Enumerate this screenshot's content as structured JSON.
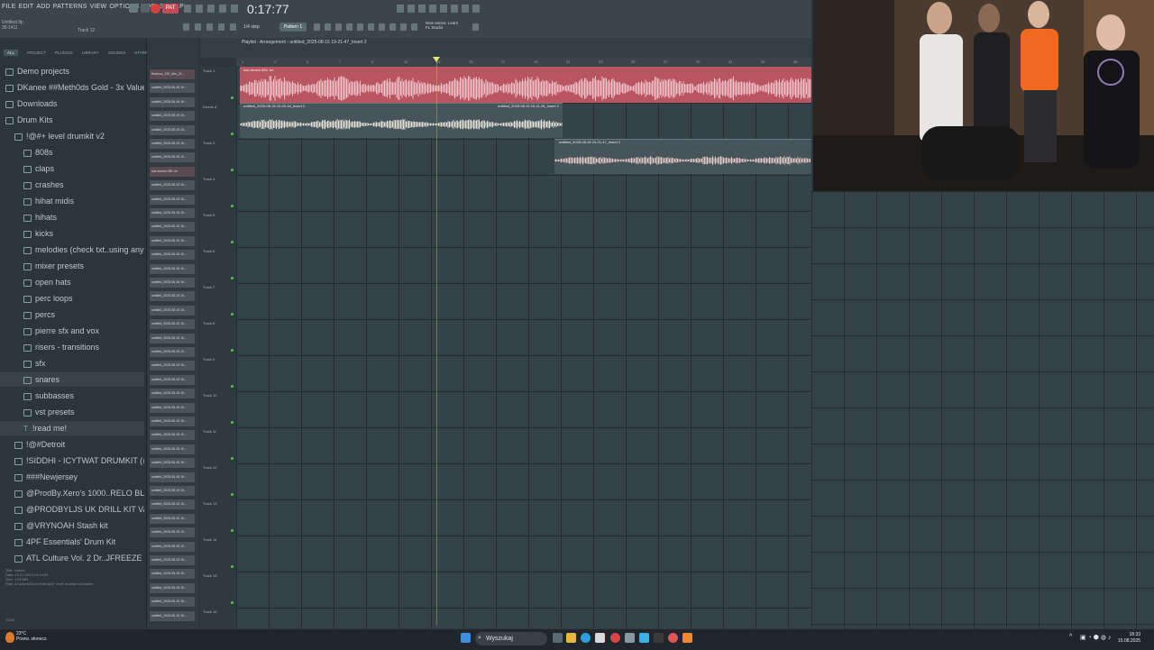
{
  "menu": [
    "FILE",
    "EDIT",
    "ADD",
    "PATTERNS",
    "VIEW",
    "OPTIONS",
    "TOOLS",
    "HELP"
  ],
  "transport": {
    "pattern_label": "PAT",
    "time": "0:17:77",
    "tempo_label": "1/4 step",
    "pattern_select": "Pattern 1"
  },
  "project_info": {
    "name": "Untitled.flp",
    "position": "36:1411",
    "track": "Track 12"
  },
  "news": [
    "New series: Learn",
    "FL Studio"
  ],
  "browser": {
    "tabs": [
      "ALL",
      "PROJECT",
      "PLUGINS",
      "LIBRARY",
      "SOUNDS",
      "STARRED"
    ],
    "items": [
      {
        "label": "Demo projects",
        "type": "folder",
        "indent": 0
      },
      {
        "label": "DKanee ##Meth0ds Gold - 3x Value Collection",
        "type": "folder",
        "indent": 0
      },
      {
        "label": "Downloads",
        "type": "folder",
        "indent": 0
      },
      {
        "label": "Drum Kits",
        "type": "folder",
        "indent": 0
      },
      {
        "label": "!@#+ level drumkit v2",
        "type": "folder",
        "indent": 1
      },
      {
        "label": "808s",
        "type": "folder",
        "indent": 2
      },
      {
        "label": "claps",
        "type": "folder",
        "indent": 2
      },
      {
        "label": "crashes",
        "type": "folder",
        "indent": 2
      },
      {
        "label": "hihat midis",
        "type": "folder",
        "indent": 2
      },
      {
        "label": "hihats",
        "type": "folder",
        "indent": 2
      },
      {
        "label": "kicks",
        "type": "folder",
        "indent": 2
      },
      {
        "label": "melodies (check txt..using any of these)",
        "type": "folder",
        "indent": 2
      },
      {
        "label": "mixer presets",
        "type": "folder",
        "indent": 2
      },
      {
        "label": "open hats",
        "type": "folder",
        "indent": 2
      },
      {
        "label": "perc loops",
        "type": "folder",
        "indent": 2
      },
      {
        "label": "percs",
        "type": "folder",
        "indent": 2
      },
      {
        "label": "pierre sfx and vox",
        "type": "folder",
        "indent": 2
      },
      {
        "label": "risers - transitions",
        "type": "folder",
        "indent": 2
      },
      {
        "label": "sfx",
        "type": "folder",
        "indent": 2
      },
      {
        "label": "snares",
        "type": "folder",
        "indent": 2,
        "selected": true
      },
      {
        "label": "subbasses",
        "type": "folder",
        "indent": 2
      },
      {
        "label": "vst presets",
        "type": "folder",
        "indent": 2
      },
      {
        "label": "!read me!",
        "type": "file",
        "indent": 2,
        "selected": true
      },
      {
        "label": "!@#Detroit",
        "type": "folder",
        "indent": 1
      },
      {
        "label": "!SIDDHI - ICYTWAT DRUMKIT (@SIMON)",
        "type": "folder",
        "indent": 1
      },
      {
        "label": "###Newjersey",
        "type": "folder",
        "indent": 1
      },
      {
        "label": "@ProdBy.Xero's 1000..RELO BLEH MEGA KIT",
        "type": "folder",
        "indent": 1
      },
      {
        "label": "@PRODBYLJS UK DRILL KIT VACCINE",
        "type": "folder",
        "indent": 1
      },
      {
        "label": "@VRYNOAH Stash kit",
        "type": "folder",
        "indent": 1
      },
      {
        "label": "4PF Essentials' Drum Kit",
        "type": "folder",
        "indent": 1
      },
      {
        "label": "ATL Culture Vol. 2 Dr..JFREEZE & Mike Fuego",
        "type": "folder",
        "indent": 1
      }
    ],
    "file_info": [
      "Title: snares",
      "Date: 19.07.2023 19:44:53",
      "Size: 1.52 MB",
      "Path: D:\\Users\\Drum Kits\\!@#+ level drumkit v2\\snares"
    ],
    "tags_label": "TAGS"
  },
  "channels": [
    "Beatscz_152_dfm_01...",
    "untitled_2025-08-15 19...",
    "untitled_2025-08-15 19...",
    "untitled_2025-08-15 19...",
    "untitled_2025-08-15 19...",
    "untitled_2025-08-15 19...",
    "untitled_2025-08-15 19...",
    "lost dshwa 089 .tm",
    "untitled_2025-08-15 19...",
    "untitled_2025-08-15 19...",
    "untitled_2025-08-15 19...",
    "untitled_2025-08-15 19...",
    "untitled_2025-08-15 19...",
    "untitled_2025-08-15 19...",
    "untitled_2025-08-15 19...",
    "untitled_2025-08-15 19...",
    "untitled_2025-08-15 19...",
    "untitled_2025-08-15 19...",
    "untitled_2025-08-15 19...",
    "untitled_2025-08-15 19...",
    "untitled_2025-08-15 19...",
    "untitled_2025-08-15 19...",
    "untitled_2025-08-15 19...",
    "untitled_2025-08-15 19...",
    "untitled_2025-08-15 19...",
    "untitled_2025-08-15 19...",
    "untitled_2025-08-15 19...",
    "untitled_2025-08-15 19...",
    "untitled_2025-08-15 19...",
    "untitled_2025-08-15 19...",
    "untitled_2025-08-15 19...",
    "untitled_2025-08-15 19...",
    "untitled_2025-08-15 19...",
    "untitled_2025-08-15 19...",
    "untitled_2025-08-15 19...",
    "untitled_2025-08-15 19...",
    "untitled_2025-08-15 19...",
    "untitled_2025-08-15 19...",
    "untitled_2025-08-15 19...",
    "untitled_2025-08-15 19..."
  ],
  "playlist": {
    "title": "Playlist - Arrangement › untitled_2025-08-15 19-21-47_Insert 2",
    "ruler": [
      "1",
      "3",
      "5",
      "7",
      "9",
      "11",
      "13",
      "15",
      "17",
      "19",
      "21",
      "23",
      "25",
      "27",
      "29",
      "31",
      "33",
      "35"
    ],
    "tracks": [
      "Track 1",
      "Drums &",
      "Track 3",
      "Track 4",
      "Track 5",
      "Track 6",
      "Track 7",
      "Track 8",
      "Track 9",
      "Track 10",
      "Track 11",
      "Track 12",
      "Track 13",
      "Track 14",
      "Track 15",
      "Track 16"
    ],
    "clips": [
      {
        "label": "lost dshwa 089 .tm"
      },
      {
        "label": "untitled_2025-08-15 19-00-18_Insert 2"
      },
      {
        "label": "untitled_2025-08-15 19-11-29_Insert 2"
      },
      {
        "label": "untitled_2025-08-15 19-21-47_Insert 2"
      }
    ]
  },
  "taskbar": {
    "weather_temp": "23°C",
    "weather_desc": "Przew. słonecz.",
    "search": "Wyszukaj",
    "time": "18:33",
    "date": "15.08.2025"
  },
  "colors": {
    "audio_clip": "#b95561",
    "grid": "#34424a",
    "accent": "#5fbf4e"
  }
}
